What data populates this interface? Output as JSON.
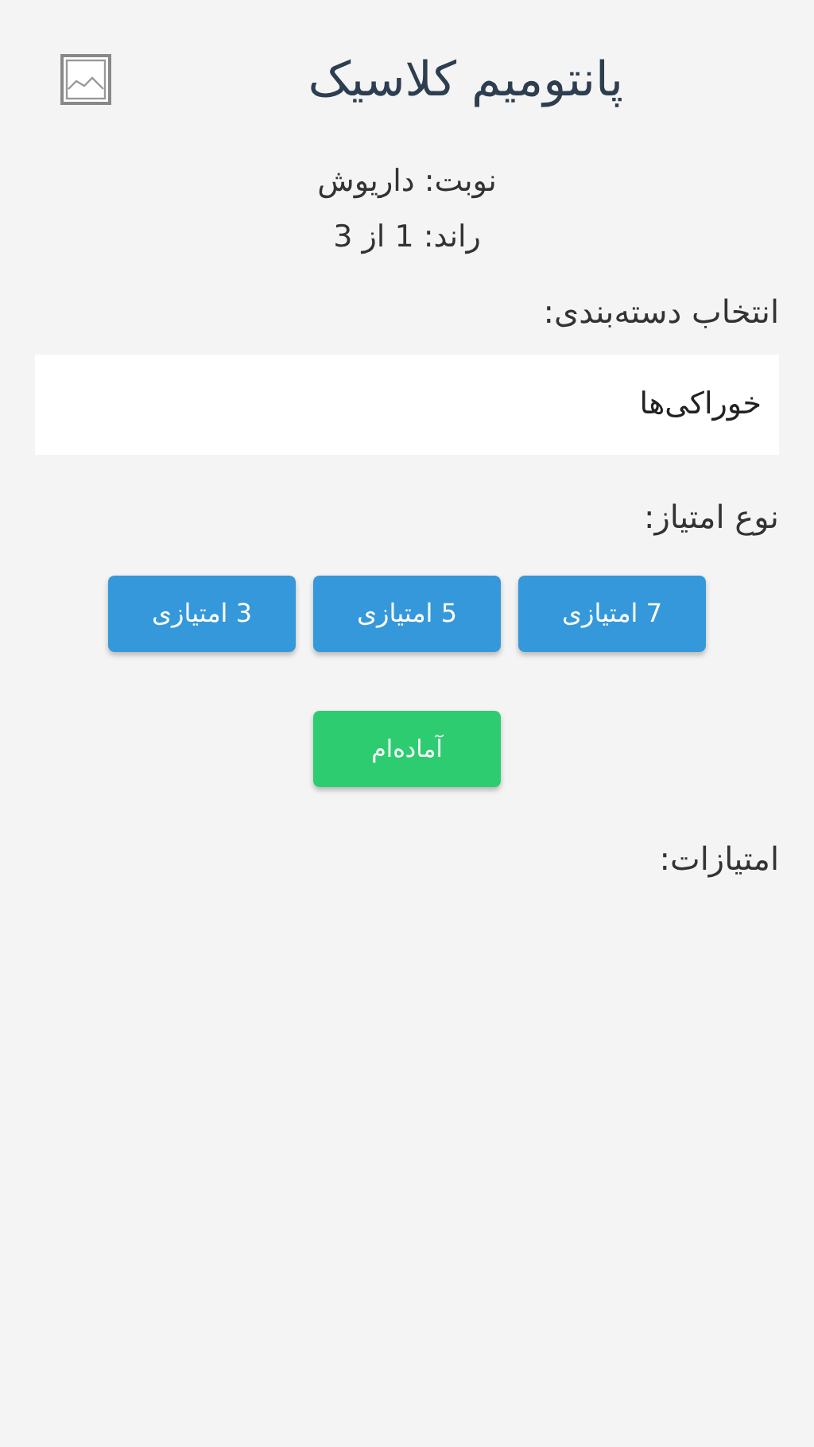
{
  "header": {
    "title": "پانتومیم کلاسیک"
  },
  "turn": "نوبت: داریوش",
  "round": "راند: 1 از 3",
  "category": {
    "label": "انتخاب دسته‌بندی:",
    "value": "خوراکی‌ها"
  },
  "points_type": {
    "label": "نوع امتیاز:",
    "options": [
      {
        "label": "7 امتیازی"
      },
      {
        "label": "5 امتیازی"
      },
      {
        "label": "3 امتیازی"
      }
    ]
  },
  "ready_button": "آماده‌ام",
  "scores": {
    "label": "امتیازات:"
  }
}
